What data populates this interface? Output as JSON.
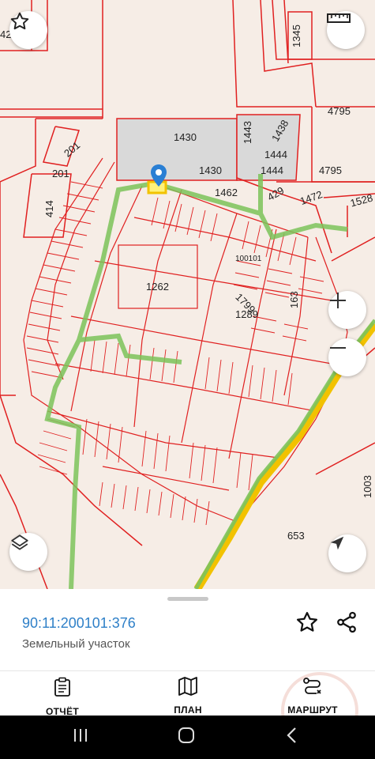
{
  "map": {
    "parcel_labels": [
      {
        "id": "1345",
        "text": "1345"
      },
      {
        "id": "4795a",
        "text": "4795"
      },
      {
        "id": "1430a",
        "text": "1430"
      },
      {
        "id": "1443",
        "text": "1443"
      },
      {
        "id": "1438",
        "text": "1438"
      },
      {
        "id": "1444a",
        "text": "1444"
      },
      {
        "id": "1444b",
        "text": "1444"
      },
      {
        "id": "1430b",
        "text": "1430"
      },
      {
        "id": "4795b",
        "text": "4795"
      },
      {
        "id": "201a",
        "text": "201"
      },
      {
        "id": "201b",
        "text": "201"
      },
      {
        "id": "414",
        "text": "414"
      },
      {
        "id": "1462",
        "text": "1462"
      },
      {
        "id": "429",
        "text": "429"
      },
      {
        "id": "1472",
        "text": "1472"
      },
      {
        "id": "1528",
        "text": "1528"
      },
      {
        "id": "1262",
        "text": "1262"
      },
      {
        "id": "1799",
        "text": "1799"
      },
      {
        "id": "163",
        "text": "163"
      },
      {
        "id": "1289",
        "text": "1289"
      },
      {
        "id": "100101",
        "text": "100101"
      },
      {
        "id": "1003",
        "text": "1003"
      },
      {
        "id": "653",
        "text": "653"
      },
      {
        "id": "42",
        "text": "42"
      }
    ],
    "colors": {
      "boundary": "#e02020",
      "route": "#7cc35a",
      "road": "#f2c200",
      "background": "#f6ede6"
    }
  },
  "parcel": {
    "cadastral_number": "90:11:200101:376",
    "type": "Земельный участок"
  },
  "tabs": [
    {
      "label": "ОТЧЁТ",
      "icon": "report-icon"
    },
    {
      "label": "ПЛАН",
      "icon": "map-icon"
    },
    {
      "label": "МАРШРУТ",
      "icon": "route-icon"
    }
  ],
  "icons": {
    "favorite_top": "star-icon",
    "ruler": "ruler-icon",
    "zoom_in": "plus-icon",
    "zoom_out": "minus-icon",
    "layers": "layers-icon",
    "locate": "navigation-arrow-icon",
    "marker": "map-pin-icon",
    "favorite_sheet": "star-icon",
    "share": "share-icon"
  }
}
